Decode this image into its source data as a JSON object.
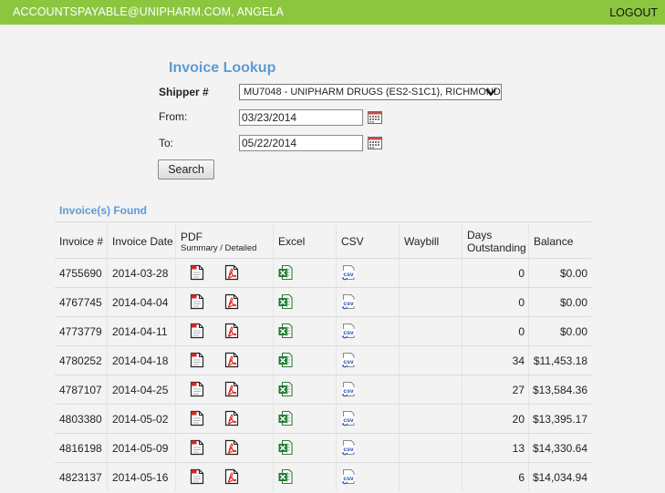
{
  "header": {
    "user": "ACCOUNTSPAYABLE@UNIPHARM.COM, ANGELA",
    "logout": "LOGOUT",
    "accent_color": "#8cc63f"
  },
  "form": {
    "title": "Invoice Lookup",
    "shipper_label": "Shipper #",
    "shipper_value": "MU7048 - UNIPHARM DRUGS (ES2-S1C1), RICHMOND",
    "from_label": "From:",
    "from_value": "03/23/2014",
    "to_label": "To:",
    "to_value": "05/22/2014",
    "search_label": "Search",
    "title_color": "#5b9bd5"
  },
  "results": {
    "heading": "Invoice(s) Found",
    "columns": {
      "invoice": "Invoice #",
      "date": "Invoice Date",
      "pdf": "PDF",
      "pdf_sub": "Summary / Detailed",
      "excel": "Excel",
      "csv": "CSV",
      "waybill": "Waybill",
      "days_line1": "Days",
      "days_line2": "Outstanding",
      "balance": "Balance"
    },
    "icons": {
      "pdf_summary": "pdf-summary-icon",
      "pdf_detailed": "pdf-detailed-icon",
      "excel": "excel-icon",
      "csv": "csv-icon"
    },
    "rows": [
      {
        "invoice": "4755690",
        "date": "2014-03-28",
        "days": "0",
        "balance": "$0.00"
      },
      {
        "invoice": "4767745",
        "date": "2014-04-04",
        "days": "0",
        "balance": "$0.00"
      },
      {
        "invoice": "4773779",
        "date": "2014-04-11",
        "days": "0",
        "balance": "$0.00"
      },
      {
        "invoice": "4780252",
        "date": "2014-04-18",
        "days": "34",
        "balance": "$11,453.18"
      },
      {
        "invoice": "4787107",
        "date": "2014-04-25",
        "days": "27",
        "balance": "$13,584.36"
      },
      {
        "invoice": "4803380",
        "date": "2014-05-02",
        "days": "20",
        "balance": "$13,395.17"
      },
      {
        "invoice": "4816198",
        "date": "2014-05-09",
        "days": "13",
        "balance": "$14,330.64"
      },
      {
        "invoice": "4823137",
        "date": "2014-05-16",
        "days": "6",
        "balance": "$14,034.94"
      }
    ]
  }
}
